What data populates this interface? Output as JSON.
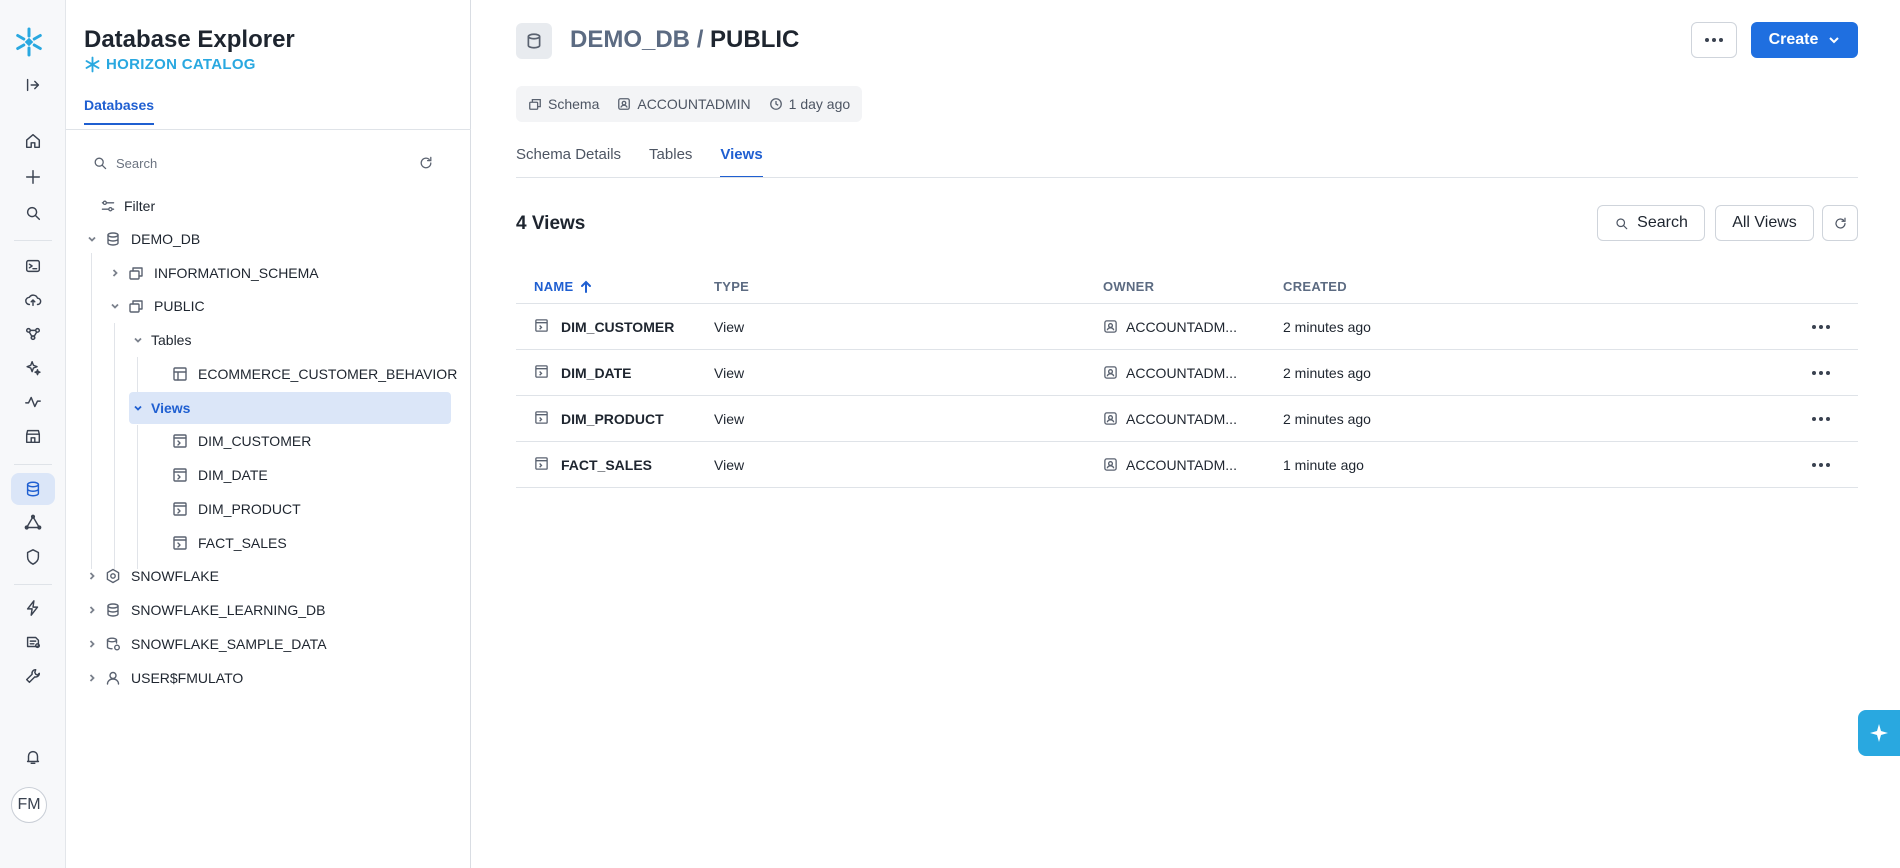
{
  "colors": {
    "accent": "#1f5fd1",
    "brand": "#29a8e0",
    "primary_button": "#1f6fe0"
  },
  "rail": {
    "avatar_initials": "FM",
    "icons": [
      "expand-icon",
      "home-icon",
      "plus-icon",
      "search-icon",
      "worksheet-icon",
      "upload-icon",
      "projects-icon",
      "ai-icon",
      "monitoring-icon",
      "marketplace-icon",
      "database-icon",
      "data-sharing-icon",
      "governance-icon",
      "lightning-icon",
      "learn-icon",
      "admin-icon",
      "bell-icon"
    ]
  },
  "explorer": {
    "title": "Database Explorer",
    "subtitle": "HORIZON CATALOG",
    "tab": "Databases",
    "search_placeholder": "Search",
    "filter_label": "Filter",
    "tree": {
      "demo_db": "DEMO_DB",
      "information_schema": "INFORMATION_SCHEMA",
      "public": "PUBLIC",
      "tables": "Tables",
      "table_1": "ECOMMERCE_CUSTOMER_BEHAVIOR",
      "views": "Views",
      "view_1": "DIM_CUSTOMER",
      "view_2": "DIM_DATE",
      "view_3": "DIM_PRODUCT",
      "view_4": "FACT_SALES",
      "snowflake": "SNOWFLAKE",
      "learning_db": "SNOWFLAKE_LEARNING_DB",
      "sample_data": "SNOWFLAKE_SAMPLE_DATA",
      "user_db": "USER$FMULATO"
    }
  },
  "main": {
    "breadcrumb": {
      "database": "DEMO_DB",
      "separator": "/",
      "schema": "PUBLIC"
    },
    "create_label": "Create",
    "meta": {
      "kind": "Schema",
      "owner": "ACCOUNTADMIN",
      "age": "1 day ago"
    },
    "tabs": [
      "Schema Details",
      "Tables",
      "Views"
    ],
    "count_title": "4 Views",
    "search_label": "Search",
    "filter_label": "All Views",
    "columns": {
      "name": "NAME",
      "type": "TYPE",
      "owner": "OWNER",
      "created": "CREATED"
    },
    "rows": [
      {
        "name": "DIM_CUSTOMER",
        "type": "View",
        "owner": "ACCOUNTADM...",
        "created": "2 minutes ago"
      },
      {
        "name": "DIM_DATE",
        "type": "View",
        "owner": "ACCOUNTADM...",
        "created": "2 minutes ago"
      },
      {
        "name": "DIM_PRODUCT",
        "type": "View",
        "owner": "ACCOUNTADM...",
        "created": "2 minutes ago"
      },
      {
        "name": "FACT_SALES",
        "type": "View",
        "owner": "ACCOUNTADM...",
        "created": "1 minute ago"
      }
    ]
  }
}
